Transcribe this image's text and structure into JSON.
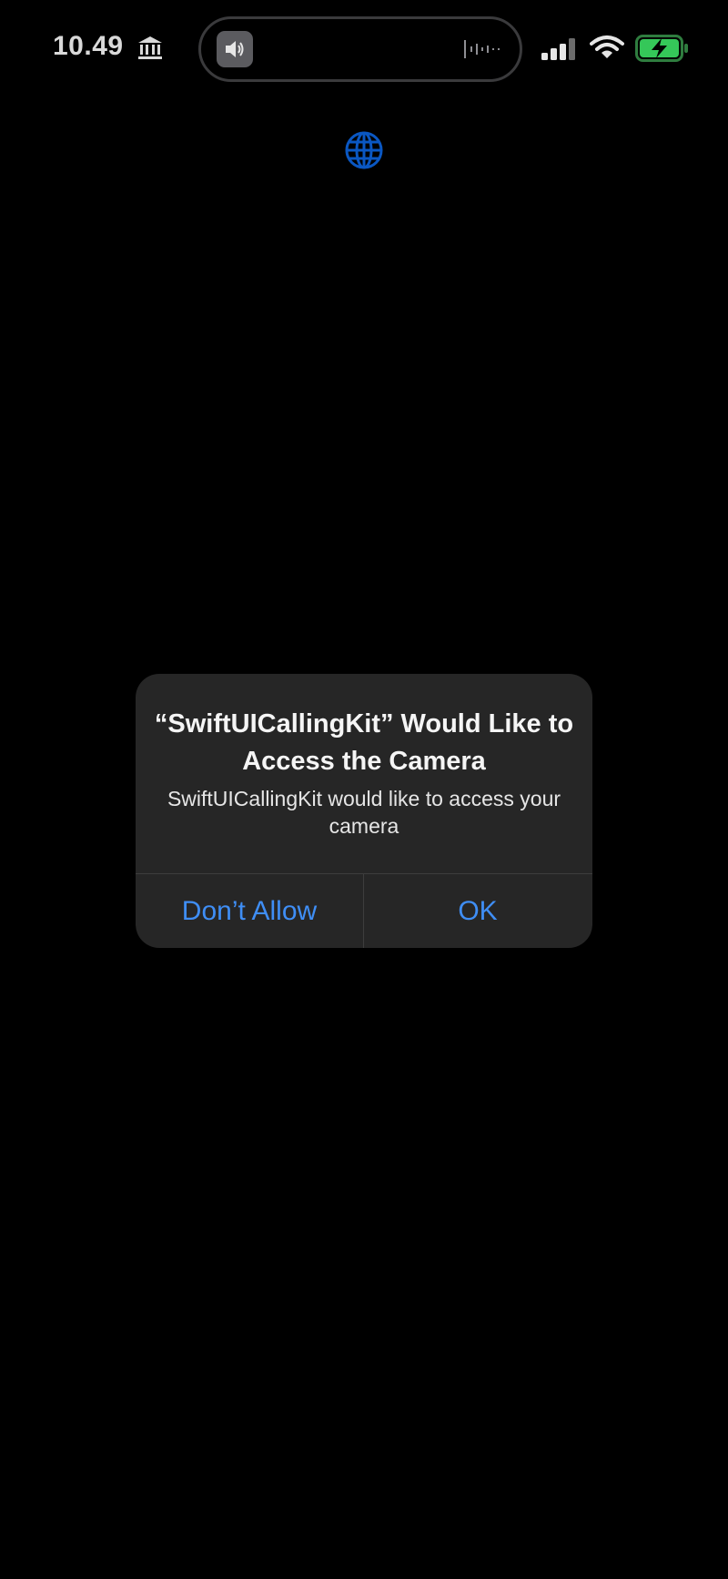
{
  "status_bar": {
    "time": "10.49",
    "icons": [
      "bank-icon",
      "speaker-icon",
      "waveform-icon",
      "signal-icon",
      "wifi-icon",
      "battery-charging-icon"
    ],
    "battery_color": "#35c759"
  },
  "app": {
    "center_icon": "globe-icon",
    "accent_color": "#0a57c2"
  },
  "alert": {
    "title": "“SwiftUICallingKit” Would Like to Access the Camera",
    "message": "SwiftUICallingKit would like to access your camera",
    "deny_label": "Don’t Allow",
    "ok_label": "OK",
    "button_color": "#3f8ef5"
  }
}
